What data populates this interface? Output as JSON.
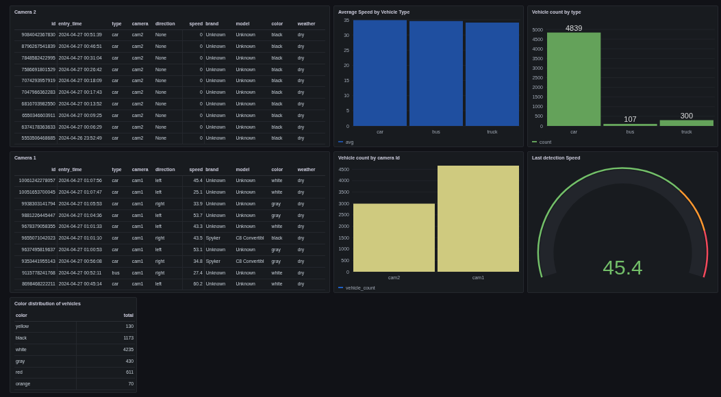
{
  "camera2_table": {
    "title": "Camera 2",
    "columns": [
      "id",
      "entry_time",
      "type",
      "camera",
      "direction",
      "speed",
      "brand",
      "model",
      "color",
      "weather"
    ],
    "rows": [
      [
        "9084042367830",
        "2024-04-27 00:51:39",
        "car",
        "cam2",
        "None",
        "0",
        "Unknown",
        "Unknown",
        "black",
        "dry"
      ],
      [
        "8796267541839",
        "2024-04-27 00:46:51",
        "car",
        "cam2",
        "None",
        "0",
        "Unknown",
        "Unknown",
        "black",
        "dry"
      ],
      [
        "7848582422995",
        "2024-04-27 00:31:04",
        "car",
        "cam2",
        "None",
        "0",
        "Unknown",
        "Unknown",
        "black",
        "dry"
      ],
      [
        "7586691801529",
        "2024-04-27 00:26:42",
        "car",
        "cam2",
        "None",
        "0",
        "Unknown",
        "Unknown",
        "black",
        "dry"
      ],
      [
        "7074293957919",
        "2024-04-27 00:18:09",
        "car",
        "cam2",
        "None",
        "0",
        "Unknown",
        "Unknown",
        "black",
        "dry"
      ],
      [
        "7047966362283",
        "2024-04-27 00:17:43",
        "car",
        "cam2",
        "None",
        "0",
        "Unknown",
        "Unknown",
        "black",
        "dry"
      ],
      [
        "6816703982550",
        "2024-04-27 00:13:52",
        "car",
        "cam2",
        "None",
        "0",
        "Unknown",
        "Unknown",
        "black",
        "dry"
      ],
      [
        "6550346603911",
        "2024-04-27 00:09:25",
        "car",
        "cam2",
        "None",
        "0",
        "Unknown",
        "Unknown",
        "black",
        "dry"
      ],
      [
        "6374178363633",
        "2024-04-27 00:06:29",
        "car",
        "cam2",
        "None",
        "0",
        "Unknown",
        "Unknown",
        "black",
        "dry"
      ],
      [
        "5553506468685",
        "2024-04-26 23:52:49",
        "car",
        "cam2",
        "None",
        "0",
        "Unknown",
        "Unknown",
        "black",
        "dry"
      ]
    ]
  },
  "avg_speed_chart": {
    "title": "Average Speed by Vehicle Type",
    "chart_data": {
      "type": "bar",
      "categories": [
        "car",
        "bus",
        "truck"
      ],
      "series": [
        {
          "name": "avg",
          "color": "#1f4fa0",
          "values": [
            34.9,
            34.6,
            34.1
          ]
        }
      ],
      "ylim": [
        0,
        35
      ],
      "grid": true,
      "yticks": [
        0,
        5,
        10,
        15,
        20,
        25,
        30,
        35
      ]
    }
  },
  "count_by_type_chart": {
    "title": "Vehicle count by type",
    "chart_data": {
      "type": "bar",
      "categories": [
        "car",
        "bus",
        "truck"
      ],
      "series": [
        {
          "name": "count",
          "color": "#64a25a",
          "values": [
            4839,
            107,
            300
          ]
        }
      ],
      "ylim": [
        0,
        5000
      ],
      "grid": true,
      "yticks": [
        0,
        500,
        1000,
        1500,
        2000,
        2500,
        3000,
        3500,
        4000,
        4500,
        5000
      ],
      "data_labels": true
    }
  },
  "camera1_table": {
    "title": "Camera 1",
    "columns": [
      "id",
      "entry_time",
      "type",
      "camera",
      "direction",
      "speed",
      "brand",
      "model",
      "color",
      "weather"
    ],
    "rows": [
      [
        "10061242278057",
        "2024-04-27 01:07:56",
        "car",
        "cam1",
        "left",
        "45.4",
        "Unknown",
        "Unknown",
        "white",
        "dry"
      ],
      [
        "10051653700045",
        "2024-04-27 01:07:47",
        "car",
        "cam1",
        "left",
        "25.1",
        "Unknown",
        "Unknown",
        "white",
        "dry"
      ],
      [
        "9938303141794",
        "2024-04-27 01:05:53",
        "car",
        "cam1",
        "right",
        "33.9",
        "Unknown",
        "Unknown",
        "gray",
        "dry"
      ],
      [
        "9881226445447",
        "2024-04-27 01:04:36",
        "car",
        "cam1",
        "left",
        "53.7",
        "Unknown",
        "Unknown",
        "gray",
        "dry"
      ],
      [
        "9678379058355",
        "2024-04-27 01:01:33",
        "car",
        "cam1",
        "left",
        "43.3",
        "Unknown",
        "Unknown",
        "white",
        "dry"
      ],
      [
        "9655071042023",
        "2024-04-27 01:01:10",
        "car",
        "cam1",
        "right",
        "43.5",
        "Spyker",
        "C8 Convertibl",
        "black",
        "dry"
      ],
      [
        "9637495819637",
        "2024-04-27 01:00:53",
        "car",
        "cam1",
        "left",
        "53.1",
        "Unknown",
        "Unknown",
        "gray",
        "dry"
      ],
      [
        "9353441955143",
        "2024-04-27 00:56:08",
        "car",
        "cam1",
        "right",
        "34.8",
        "Spyker",
        "C8 Convertibl",
        "gray",
        "dry"
      ],
      [
        "9115778241768",
        "2024-04-27 00:52:11",
        "bus",
        "cam1",
        "right",
        "27.4",
        "Unknown",
        "Unknown",
        "white",
        "dry"
      ],
      [
        "8698468222211",
        "2024-04-27 00:45:14",
        "car",
        "cam1",
        "left",
        "60.2",
        "Unknown",
        "Unknown",
        "white",
        "dry"
      ]
    ]
  },
  "count_by_camera_chart": {
    "title": "Vehicle count by camera Id",
    "legend": {
      "color": "#1f60c4"
    },
    "chart_data": {
      "type": "bar",
      "categories": [
        "cam2",
        "cam1"
      ],
      "series": [
        {
          "name": "vehicle_count",
          "color": "#cfca7f",
          "values": [
            2990,
            4660
          ]
        }
      ],
      "ylim": [
        0,
        4660
      ],
      "grid": true,
      "yticks": [
        0,
        500,
        1000,
        1500,
        2000,
        2500,
        3000,
        3500,
        4000,
        4500
      ]
    }
  },
  "last_speed_gauge": {
    "title": "Last detection Speed",
    "value": "45.4"
  },
  "color_table": {
    "title": "Color distribution of vehicles",
    "columns": [
      "color",
      "total"
    ],
    "rows": [
      [
        "yellow",
        "130"
      ],
      [
        "black",
        "1173"
      ],
      [
        "white",
        "4235"
      ],
      [
        "gray",
        "430"
      ],
      [
        "red",
        "611"
      ],
      [
        "orange",
        "70"
      ]
    ]
  }
}
